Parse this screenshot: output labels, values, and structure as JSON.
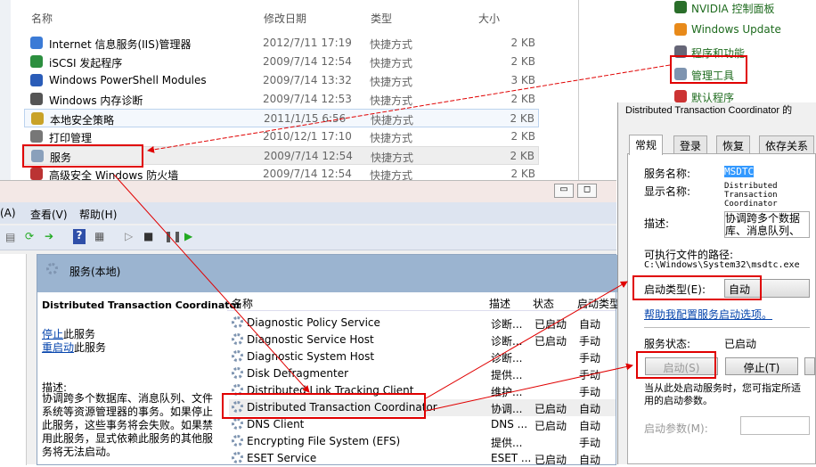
{
  "explorer": {
    "headers": [
      "名称",
      "修改日期",
      "类型",
      "大小"
    ],
    "rows": [
      {
        "name": "Internet 信息服务(IIS)管理器",
        "date": "2012/7/11 17:19",
        "type": "快捷方式",
        "size": "2 KB"
      },
      {
        "name": "iSCSI 发起程序",
        "date": "2009/7/14 12:54",
        "type": "快捷方式",
        "size": "2 KB"
      },
      {
        "name": "Windows PowerShell Modules",
        "date": "2009/7/14 13:32",
        "type": "快捷方式",
        "size": "3 KB"
      },
      {
        "name": "Windows 内存诊断",
        "date": "2009/7/14 12:53",
        "type": "快捷方式",
        "size": "2 KB"
      },
      {
        "name": "本地安全策略",
        "date": "2011/1/15 6:56",
        "type": "快捷方式",
        "size": "2 KB"
      },
      {
        "name": "打印管理",
        "date": "2010/12/1 17:10",
        "type": "快捷方式",
        "size": "2 KB"
      },
      {
        "name": "服务",
        "date": "2009/7/14 12:54",
        "type": "快捷方式",
        "size": "2 KB"
      },
      {
        "name": "高级安全 Windows 防火墙",
        "date": "2009/7/14 12:54",
        "type": "快捷方式",
        "size": "2 KB"
      }
    ]
  },
  "control_panel": {
    "items": [
      "NVIDIA 控制面板",
      "Windows Update",
      "程序和功能",
      "管理工具",
      "默认程序"
    ]
  },
  "services": {
    "menu": [
      "(A)",
      "查看(V)",
      "帮助(H)"
    ],
    "band_title": "服务(本地)",
    "selected_title": "Distributed Transaction Coordinator",
    "stop_link": "停止",
    "stop_suffix": "此服务",
    "restart_link": "重启动",
    "restart_suffix": "此服务",
    "desc_label": "描述:",
    "desc_text": "协调跨多个数据库、消息队列、文件系统等资源管理器的事务。如果停止此服务，这些事务将会失败。如果禁用此服务，显式依赖此服务的其他服务将无法启动。",
    "columns": [
      "名称",
      "描述",
      "状态",
      "启动类型"
    ],
    "rows": [
      {
        "name": "Diagnostic Policy Service",
        "desc": "诊断...",
        "status": "已启动",
        "startup": "自动"
      },
      {
        "name": "Diagnostic Service Host",
        "desc": "诊断...",
        "status": "已启动",
        "startup": "手动"
      },
      {
        "name": "Diagnostic System Host",
        "desc": "诊断...",
        "status": "",
        "startup": "手动"
      },
      {
        "name": "Disk Defragmenter",
        "desc": "提供...",
        "status": "",
        "startup": "手动"
      },
      {
        "name": "Distributed Link Tracking Client",
        "desc": "维护...",
        "status": "",
        "startup": "手动"
      },
      {
        "name": "Distributed Transaction Coordinator",
        "desc": "协调...",
        "status": "已启动",
        "startup": "自动"
      },
      {
        "name": "DNS Client",
        "desc": "DNS ...",
        "status": "已启动",
        "startup": "自动"
      },
      {
        "name": "Encrypting File System (EFS)",
        "desc": "提供...",
        "status": "",
        "startup": "手动"
      },
      {
        "name": "ESET Service",
        "desc": "ESET ...",
        "status": "已启动",
        "startup": "自动"
      }
    ]
  },
  "dialog": {
    "title": "Distributed Transaction Coordinator 的",
    "tabs": [
      "常规",
      "登录",
      "恢复",
      "依存关系"
    ],
    "service_name_label": "服务名称:",
    "service_name": "MSDTC",
    "display_name_label": "显示名称:",
    "display_name": "Distributed Transaction Coordinator",
    "desc_label": "描述:",
    "desc": "协调跨多个数据库、消息队列、文件系统等资源管理器的事务。如",
    "path_label": "可执行文件的路径:",
    "path": "C:\\Windows\\System32\\msdtc.exe",
    "startup_label": "启动类型(E):",
    "startup_value": "自动",
    "help_link": "帮助我配置服务启动选项。",
    "status_label": "服务状态:",
    "status_value": "已启动",
    "start_btn": "启动(S)",
    "stop_btn": "停止(T)",
    "hint": "当从此处启动服务时，您可指定所适用的启动参数。",
    "params_label": "启动参数(M):"
  },
  "colors": {
    "annotation": "#e00000",
    "band": "#9bb4d0",
    "link": "#0645ad"
  }
}
